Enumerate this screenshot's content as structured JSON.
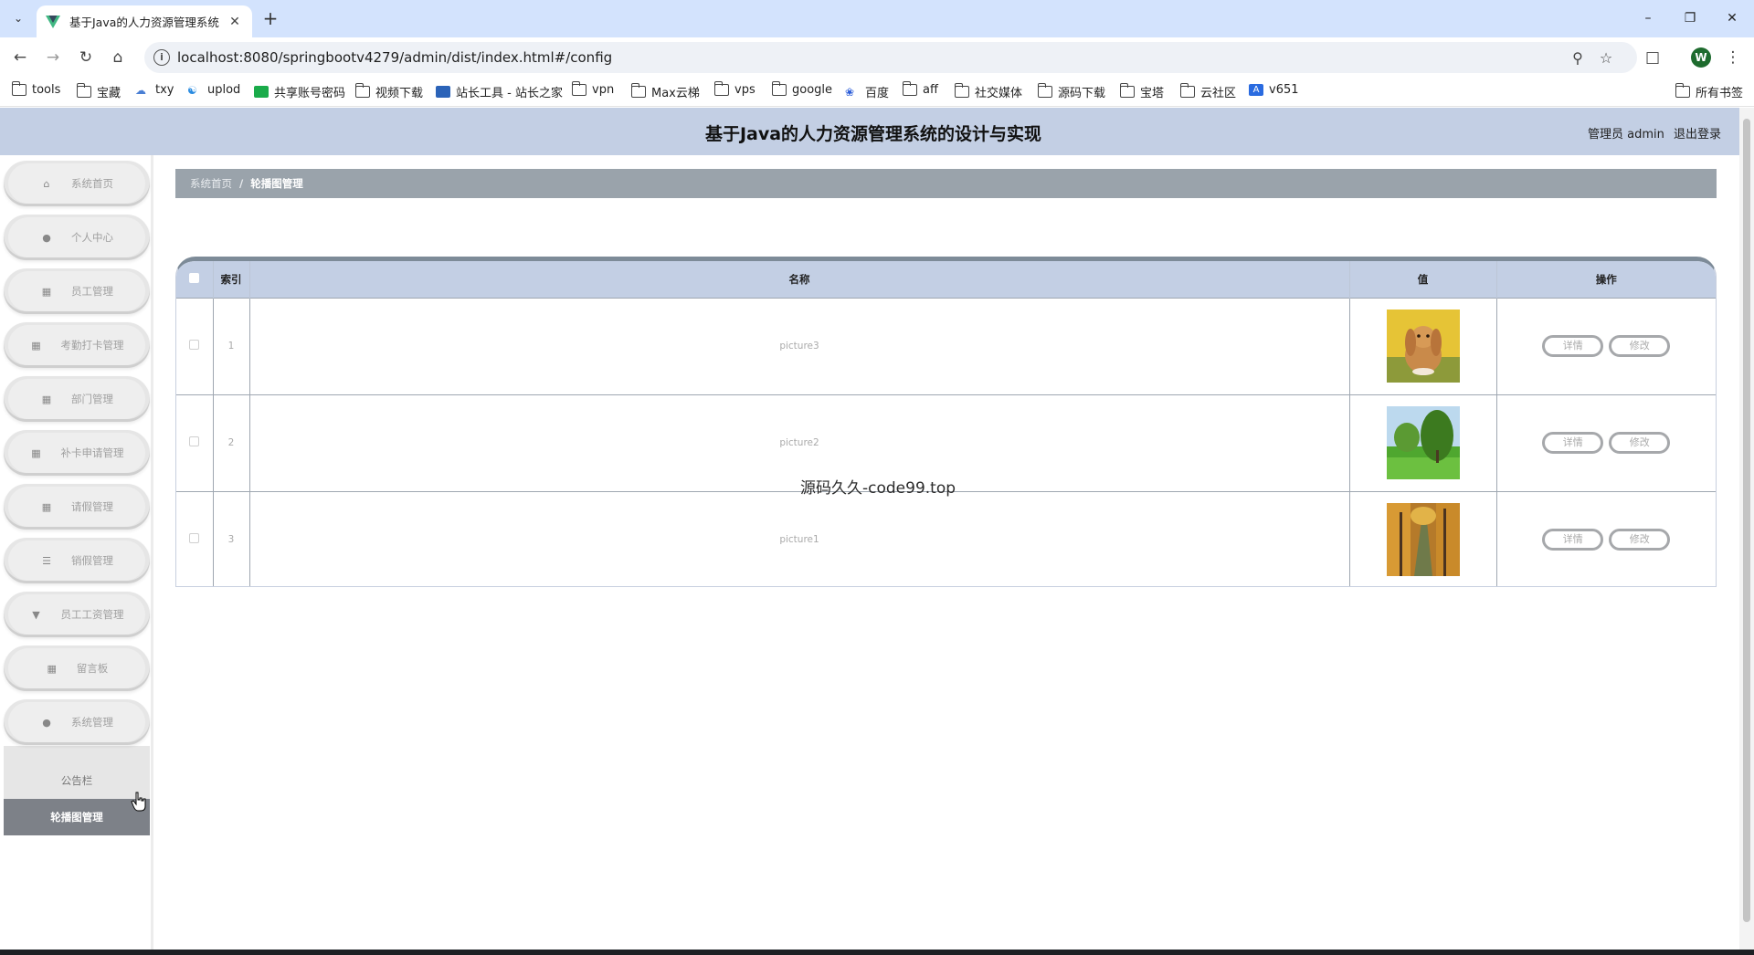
{
  "browser": {
    "tab_title": "基于Java的人力资源管理系统的",
    "url": "localhost:8080/springbootv4279/admin/dist/index.html#/config",
    "bookmarks": [
      "tools",
      "宝藏",
      "txy",
      "uplod",
      "共享账号密码",
      "视频下载",
      "站长工具 - 站长之家",
      "vpn",
      "Max云梯",
      "vps",
      "google",
      "百度",
      "aff",
      "社交媒体",
      "源码下载",
      "宝塔",
      "云社区",
      "v651"
    ],
    "all_bookmarks": "所有书签",
    "profile_initial": "W"
  },
  "header": {
    "title": "基于Java的人力资源管理系统的设计与实现",
    "user_label": "管理员 admin",
    "logout": "退出登录"
  },
  "sidebar": {
    "items": [
      {
        "label": "系统首页",
        "icon": "home-icon"
      },
      {
        "label": "个人中心",
        "icon": "user-icon"
      },
      {
        "label": "员工管理",
        "icon": "grid-icon"
      },
      {
        "label": "考勤打卡管理",
        "icon": "grid-icon"
      },
      {
        "label": "部门管理",
        "icon": "grid-icon"
      },
      {
        "label": "补卡申请管理",
        "icon": "grid-icon"
      },
      {
        "label": "请假管理",
        "icon": "grid-icon"
      },
      {
        "label": "销假管理",
        "icon": "list-icon"
      },
      {
        "label": "员工工资管理",
        "icon": "pin-icon"
      },
      {
        "label": "留言板",
        "icon": "grid-icon"
      },
      {
        "label": "系统管理",
        "icon": "user-icon"
      }
    ],
    "submenu": [
      "公告栏",
      "轮播图管理"
    ]
  },
  "breadcrumb": [
    "系统首页",
    "轮播图管理"
  ],
  "table": {
    "headers": [
      "索引",
      "名称",
      "值",
      "操作"
    ],
    "rows": [
      {
        "index": "1",
        "name": "picture3",
        "image": "rabbit"
      },
      {
        "index": "2",
        "name": "picture2",
        "image": "willow-tree"
      },
      {
        "index": "3",
        "name": "picture1",
        "image": "autumn-forest"
      }
    ],
    "detail_button": "详情",
    "edit_button": "修改"
  },
  "watermark": "源码久久-code99.top",
  "colors": {
    "header_bg": "#c3cfe4",
    "breadcrumb_bg": "#9aa3ab",
    "active_menu": "#7d8188"
  }
}
